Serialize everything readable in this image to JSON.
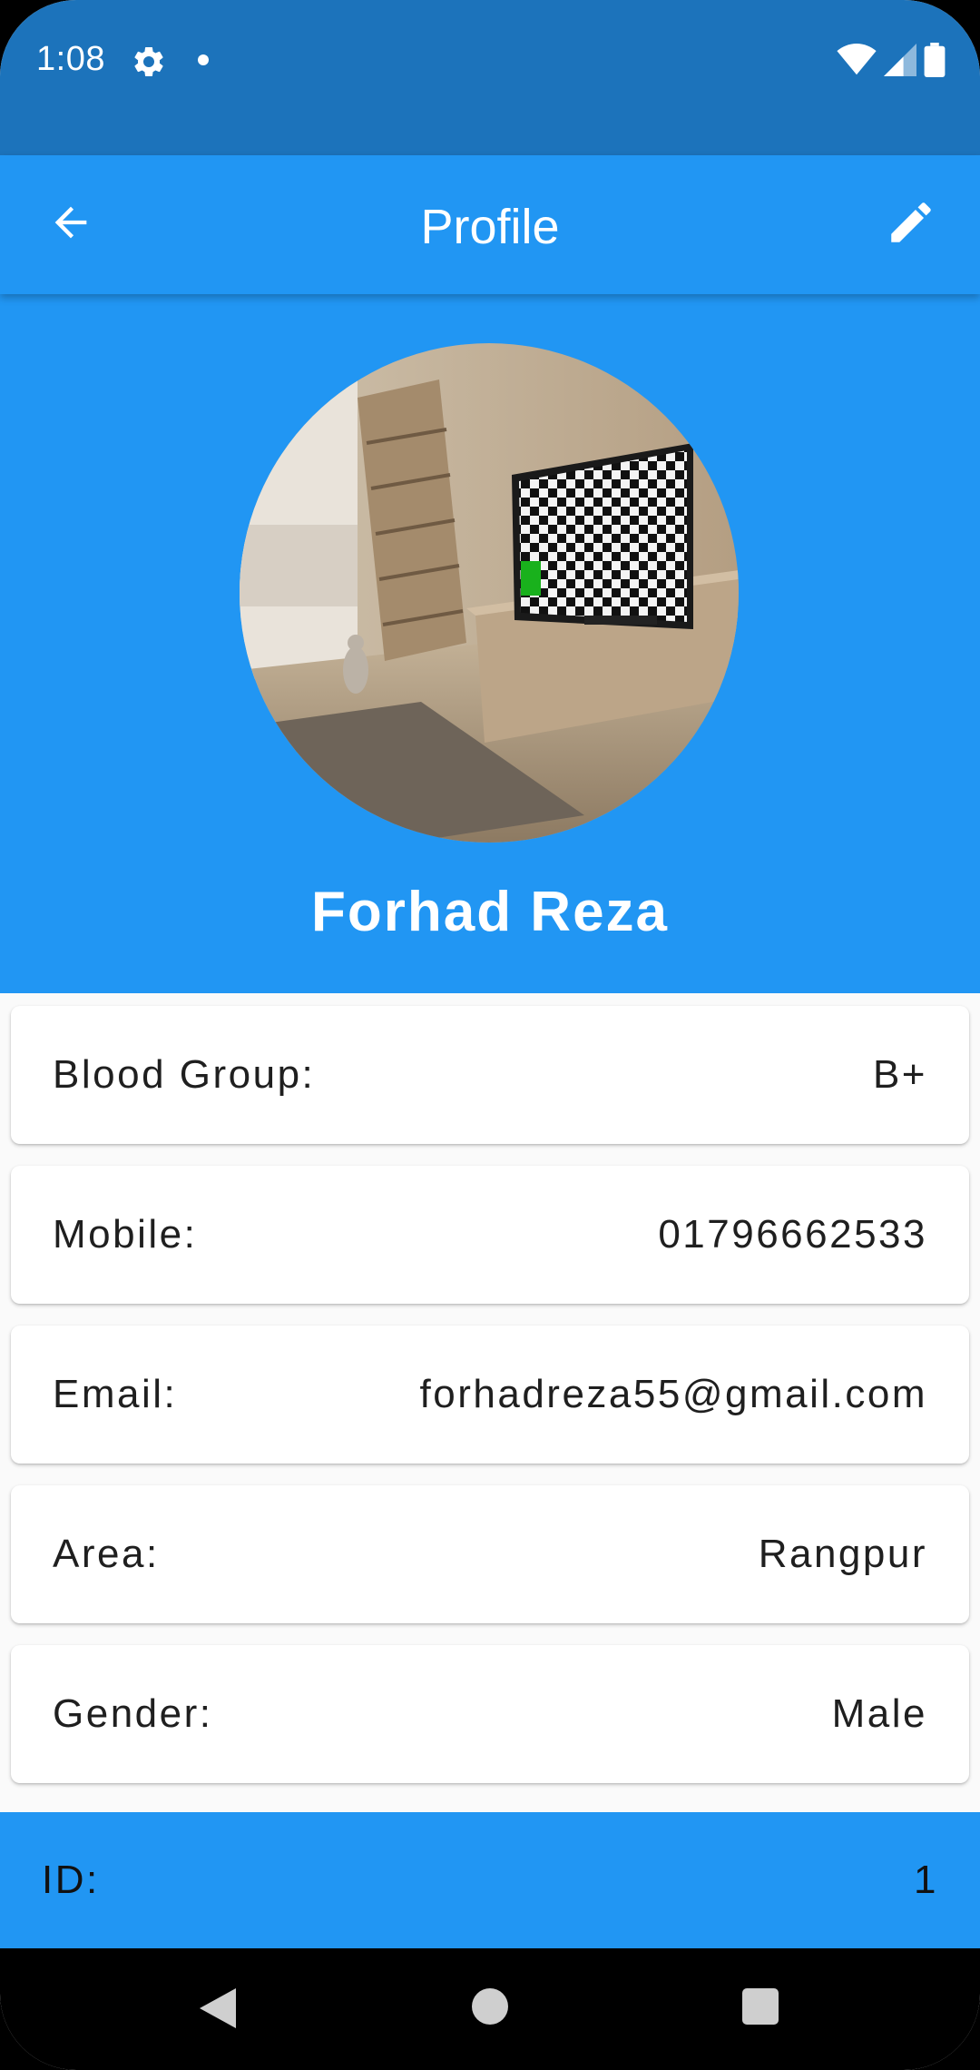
{
  "status_bar": {
    "time": "1:08",
    "icons": [
      "gear-icon",
      "dot-icon",
      "wifi-icon",
      "signal-icon",
      "battery-icon"
    ]
  },
  "app_bar": {
    "title": "Profile",
    "back_icon": "arrow-back-icon",
    "edit_icon": "pencil-icon"
  },
  "profile": {
    "name": "Forhad Reza",
    "avatar": "room-photo"
  },
  "details": [
    {
      "label": "Blood Group:",
      "value": "B+"
    },
    {
      "label": "Mobile:",
      "value": "01796662533"
    },
    {
      "label": "Email:",
      "value": "forhadreza55@gmail.com"
    },
    {
      "label": "Area:",
      "value": "Rangpur"
    },
    {
      "label": "Gender:",
      "value": "Male"
    }
  ],
  "footer": {
    "label": "ID:",
    "value": "1"
  },
  "colors": {
    "status_bar": "#1c73bb",
    "primary": "#2196f3",
    "background": "#fafafa",
    "card": "#ffffff"
  }
}
